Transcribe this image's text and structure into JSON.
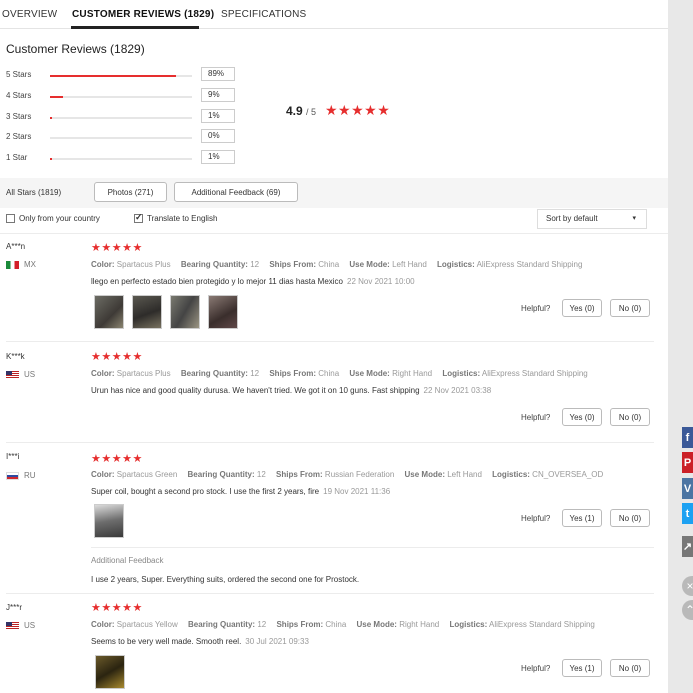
{
  "tabs": [
    {
      "label": "OVERVIEW"
    },
    {
      "label": "CUSTOMER REVIEWS (1829)"
    },
    {
      "label": "SPECIFICATIONS"
    }
  ],
  "summary": {
    "title": "Customer Reviews (1829)",
    "rating": "4.9",
    "rating_suffix": "/ 5",
    "stars": "★★★★★",
    "breakdown": [
      {
        "label": "5 Stars",
        "pct": "89%",
        "fraction": 0.89
      },
      {
        "label": "4 Stars",
        "pct": "9%",
        "fraction": 0.09
      },
      {
        "label": "3 Stars",
        "pct": "1%",
        "fraction": 0.01
      },
      {
        "label": "2 Stars",
        "pct": "0%",
        "fraction": 0.0
      },
      {
        "label": "1 Star",
        "pct": "1%",
        "fraction": 0.01
      }
    ]
  },
  "filters": {
    "all_stars": "All Stars (1819)",
    "photos": "Photos (271)",
    "additional_feedback": "Additional Feedback (69)",
    "only_from_country": "Only from your country",
    "translate": "Translate to English",
    "sort": "Sort by default"
  },
  "helpful_label": "Helpful?",
  "reviews": [
    {
      "name": "A***n",
      "country": "MX",
      "stars": "★★★★★",
      "color": "Spartacus Plus",
      "bearing": "12",
      "ships_from": "China",
      "use_mode": "Left Hand",
      "logistics": "AliExpress Standard Shipping",
      "text": "llego en perfecto estado bien protegido y lo mejor 11 dias hasta Mexico",
      "date": "22 Nov 2021 10:00",
      "yes": "Yes (0)",
      "no": "No (0)"
    },
    {
      "name": "K***k",
      "country": "US",
      "stars": "★★★★★",
      "color": "Spartacus Plus",
      "bearing": "12",
      "ships_from": "China",
      "use_mode": "Right Hand",
      "logistics": "AliExpress Standard Shipping",
      "text": "Urun has nice and good quality durusa. We haven't tried. We got it on 10 guns. Fast shipping",
      "date": "22 Nov 2021 03:38",
      "yes": "Yes (0)",
      "no": "No (0)"
    },
    {
      "name": "I***i",
      "country": "RU",
      "stars": "★★★★★",
      "color": "Spartacus Green",
      "bearing": "12",
      "ships_from": "Russian Federation",
      "use_mode": "Left Hand",
      "logistics": "CN_OVERSEA_OD",
      "text": "Super coil, bought a second pro stock. I use the first 2 years, fire",
      "date": "19 Nov 2021 11:36",
      "yes": "Yes (1)",
      "no": "No (0)",
      "additional_title": "Additional Feedback",
      "additional_text": "I use 2 years, Super. Everything suits, ordered the second one for Prostock."
    },
    {
      "name": "J***r",
      "country": "US",
      "stars": "★★★★★",
      "color": "Spartacus Yellow",
      "bearing": "12",
      "ships_from": "China",
      "use_mode": "Right Hand",
      "logistics": "AliExpress Standard Shipping",
      "text": "Seems to be very well made. Smooth reel.",
      "date": "30 Jul 2021 09:33",
      "yes": "Yes (1)",
      "no": "No (0)"
    }
  ],
  "attr_labels": {
    "color": "Color:",
    "bearing": "Bearing Quantity:",
    "ships_from": "Ships From:",
    "use_mode": "Use Mode:",
    "logistics": "Logistics:"
  },
  "share_icons": [
    "facebook-icon",
    "pinterest-icon",
    "vk-icon",
    "twitter-icon",
    "link-icon"
  ],
  "colors": {
    "accent": "#e62e2e",
    "facebook": "#3b5998",
    "pinterest": "#cb2027",
    "vk": "#4c75a3",
    "twitter": "#1da1f2"
  }
}
